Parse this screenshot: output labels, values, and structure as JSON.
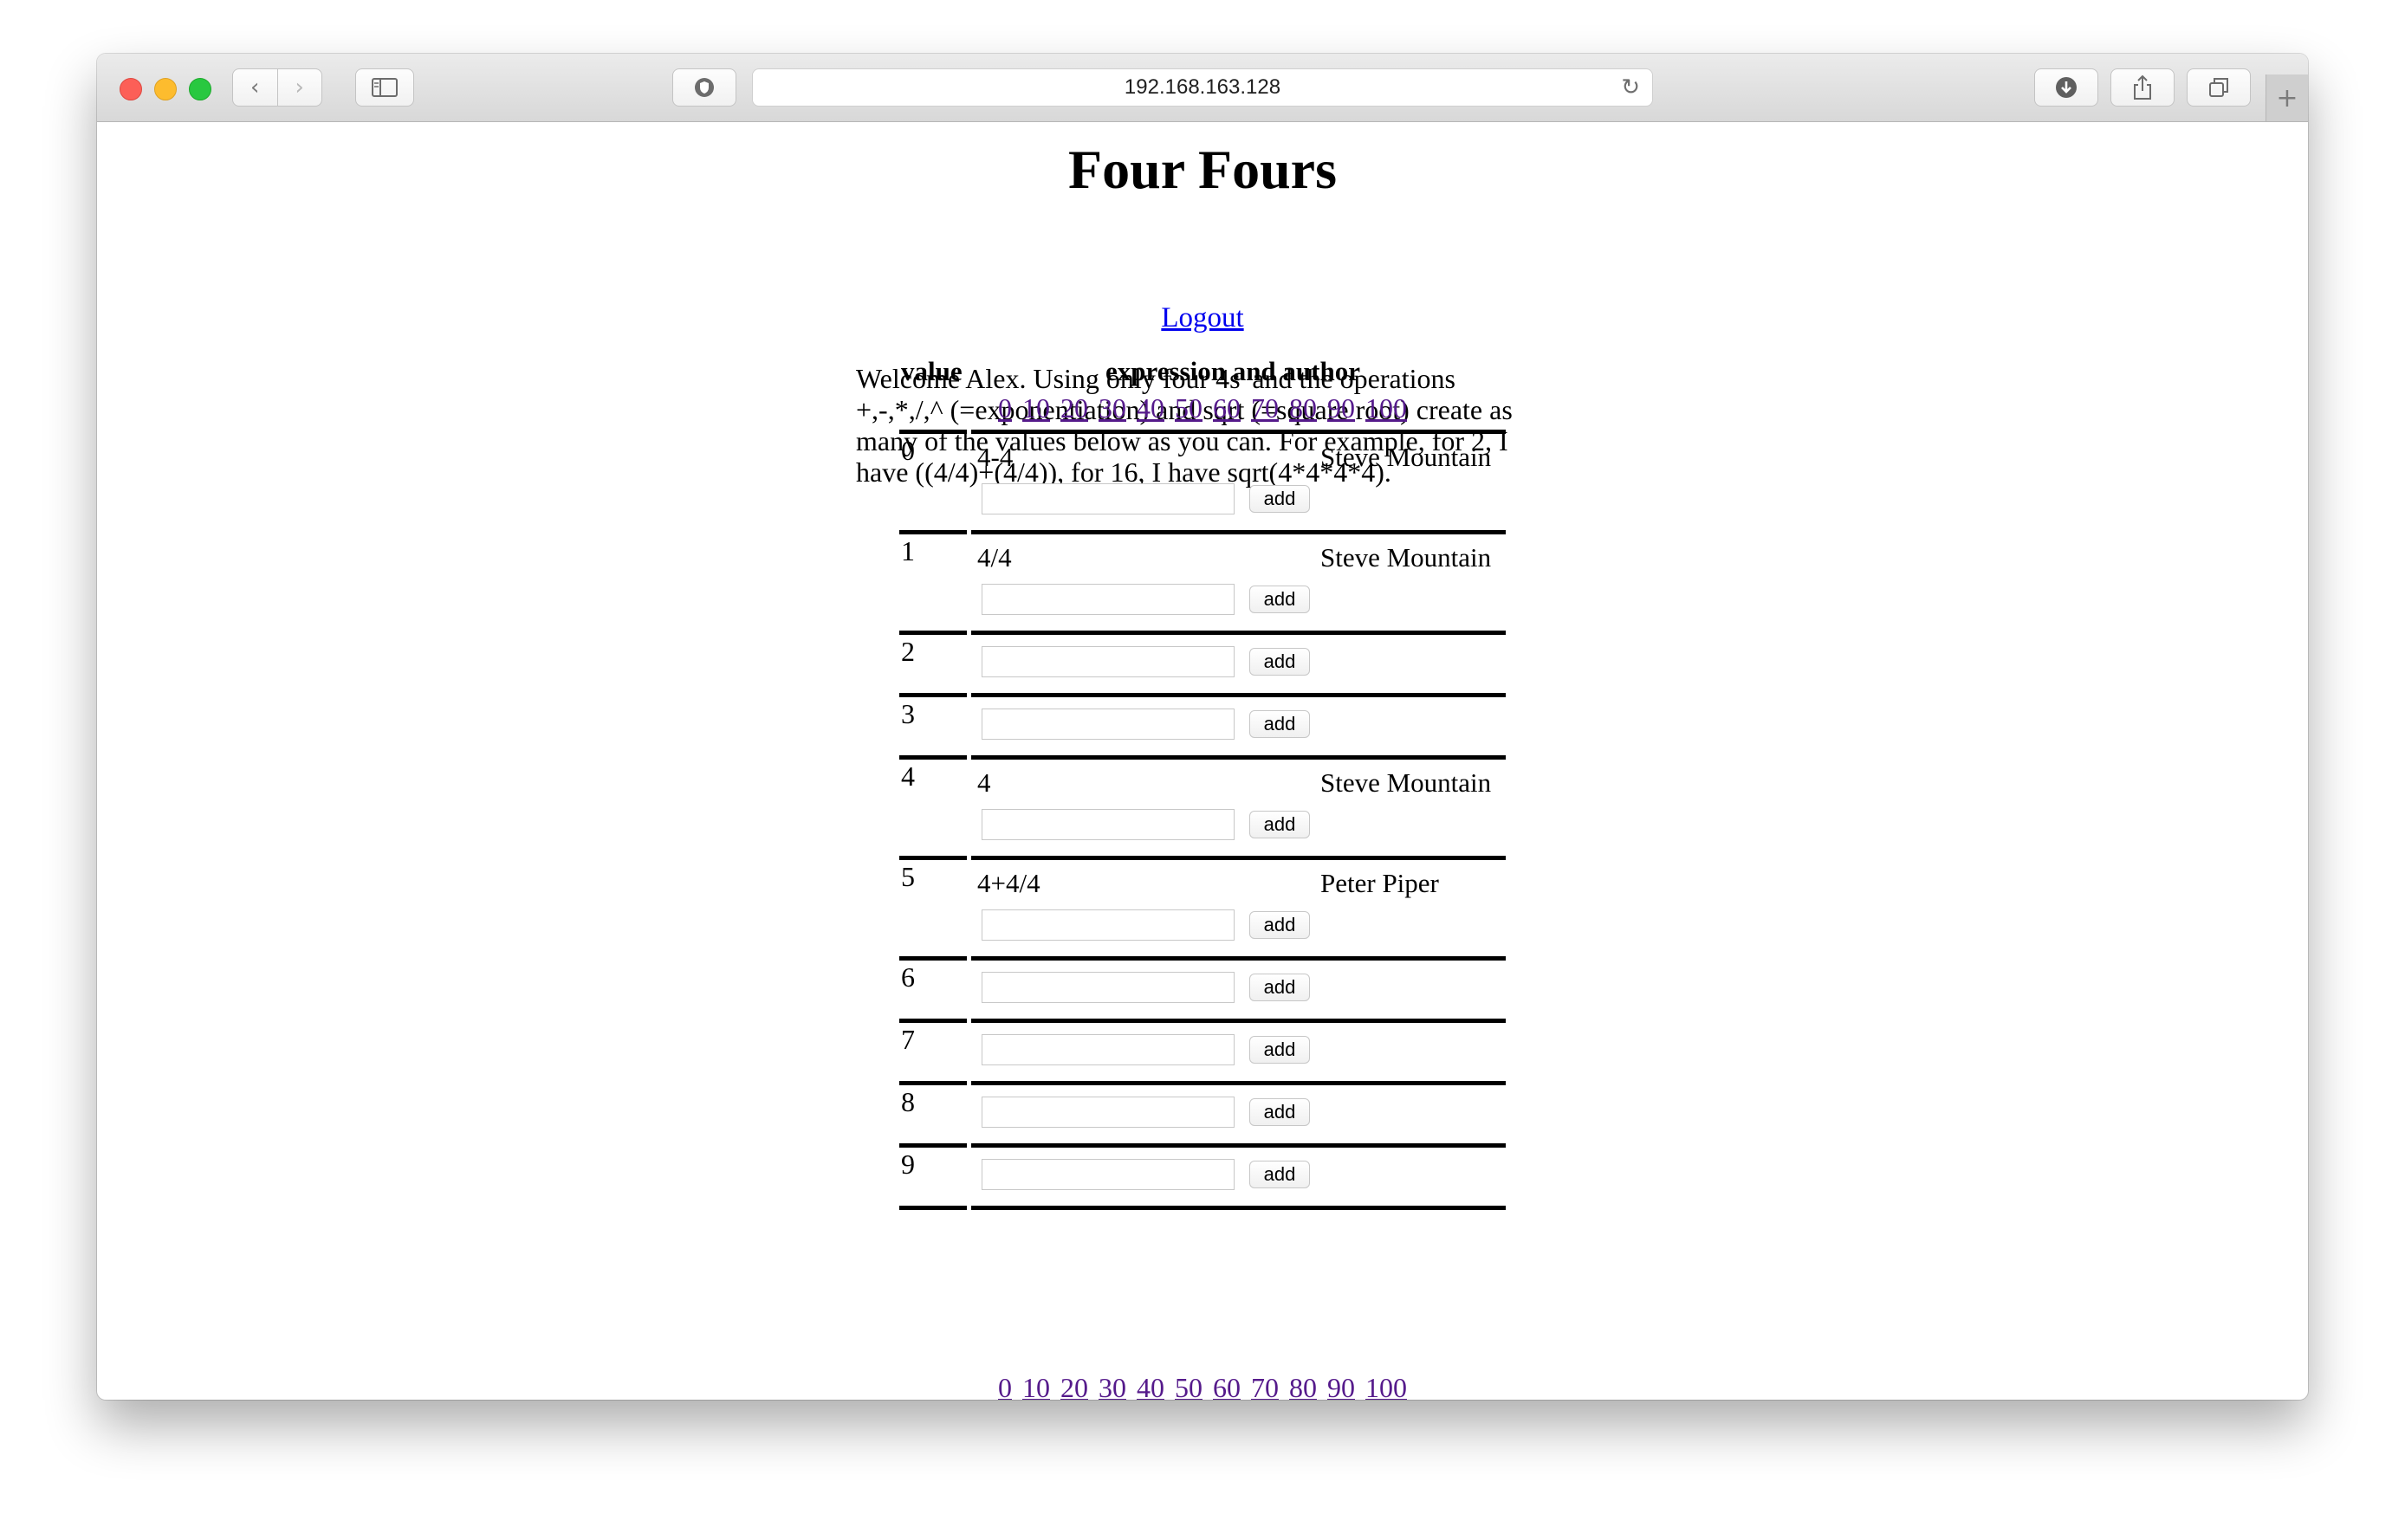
{
  "browser": {
    "url": "192.168.163.128",
    "icons": {
      "back": "chevron-left-icon",
      "forward": "chevron-right-icon",
      "sidebar": "sidebar-icon",
      "shield": "shield-icon",
      "reload": "reload-icon",
      "download": "download-icon",
      "share": "share-icon",
      "tabs": "tabs-icon",
      "new_tab": "plus-icon"
    }
  },
  "page": {
    "title": "Four Fours",
    "logout_label": "Logout",
    "intro": "Welcome Alex. Using only four 4s' and the operations +,-,*,/,^ (=exponentiation) and sqrt (=square root) create as many of the values below as you can. For example, for 2, I have ((4/4)+(4/4)), for 16, I have sqrt(4*4*4*4).",
    "table": {
      "col_value": "value",
      "col_expression": "expression and author",
      "page_links": [
        "0",
        "10",
        "20",
        "30",
        "40",
        "50",
        "60",
        "70",
        "80",
        "90",
        "100"
      ],
      "add_label": "add",
      "rows": [
        {
          "value": "0",
          "expression": "4-4",
          "author": "Steve Mountain"
        },
        {
          "value": "1",
          "expression": "4/4",
          "author": "Steve Mountain"
        },
        {
          "value": "2",
          "expression": "",
          "author": ""
        },
        {
          "value": "3",
          "expression": "",
          "author": ""
        },
        {
          "value": "4",
          "expression": "4",
          "author": "Steve Mountain"
        },
        {
          "value": "5",
          "expression": "4+4/4",
          "author": "Peter Piper"
        },
        {
          "value": "6",
          "expression": "",
          "author": ""
        },
        {
          "value": "7",
          "expression": "",
          "author": ""
        },
        {
          "value": "8",
          "expression": "",
          "author": ""
        },
        {
          "value": "9",
          "expression": "",
          "author": ""
        }
      ]
    }
  },
  "colors": {
    "link": "#0000ee",
    "visited_link": "#551a8b"
  }
}
